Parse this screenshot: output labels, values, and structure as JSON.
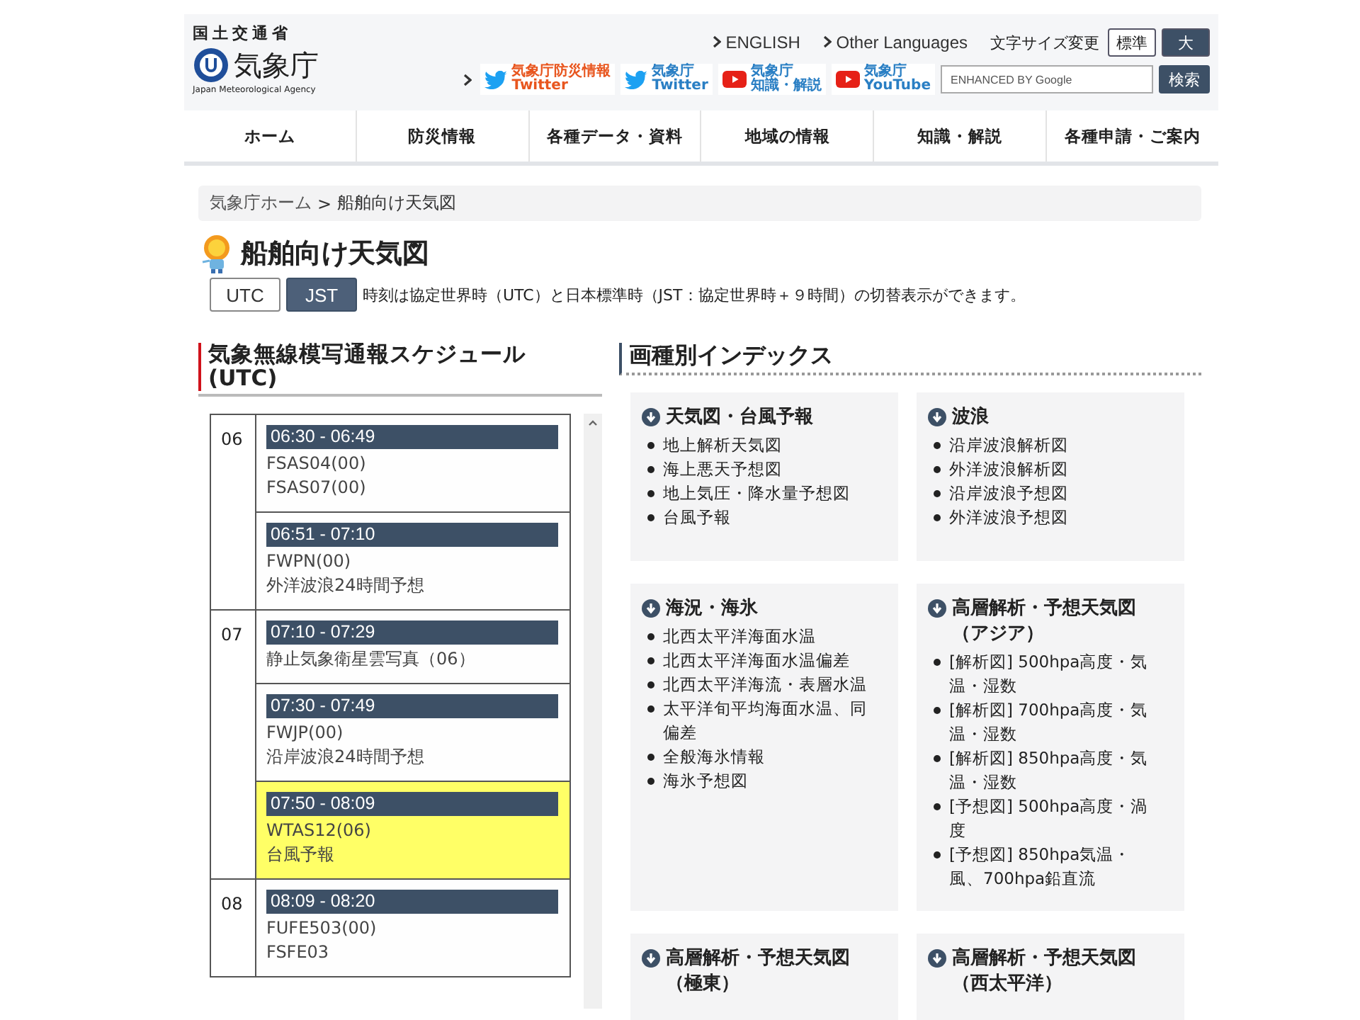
{
  "header": {
    "ministry": "国土交通省",
    "agency": "気象庁",
    "agency_en": "Japan Meteorological Agency",
    "links": [
      "ENGLISH",
      "Other Languages"
    ],
    "font_size": {
      "label": "文字サイズ変更",
      "options": [
        {
          "label": "標準",
          "selected": false
        },
        {
          "label": "大",
          "selected": true
        }
      ]
    },
    "banners": [
      {
        "kind": "twitter",
        "lines": [
          "気象庁防災情報",
          "Twitter"
        ],
        "color": "#e8561f"
      },
      {
        "kind": "twitter",
        "lines": [
          "気象庁",
          "Twitter"
        ],
        "color": "#2a7fc4"
      },
      {
        "kind": "youtube",
        "lines": [
          "気象庁",
          "知識・解説"
        ],
        "color": "#2a7fc4"
      },
      {
        "kind": "youtube",
        "lines": [
          "気象庁",
          "YouTube"
        ],
        "color": "#2a7fc4"
      }
    ],
    "search": {
      "placeholder": "ENHANCED BY Google",
      "button": "検索"
    }
  },
  "nav": [
    "ホーム",
    "防災情報",
    "各種データ・資料",
    "地域の情報",
    "知識・解説",
    "各種申請・ご案内"
  ],
  "breadcrumb": [
    "気象庁ホーム",
    ">",
    "船舶向け天気図"
  ],
  "title": "船舶向け天気図",
  "time_toggle": [
    {
      "label": "UTC",
      "selected": false
    },
    {
      "label": "JST",
      "selected": true
    }
  ],
  "toggle_note": "時刻は協定世界時（UTC）と日本標準時（JST：協定世界時＋９時間）の切替表示ができます。",
  "schedule": {
    "title": "気象無線模写通報スケジュール(UTC)",
    "hours": [
      {
        "hour": "06",
        "slots": [
          {
            "time": "06:30 - 06:49",
            "lines": [
              "FSAS04(00)",
              "FSAS07(00)"
            ],
            "highlighted": false
          },
          {
            "time": "06:51 - 07:10",
            "lines": [
              "FWPN(00)",
              "外洋波浪24時間予想"
            ],
            "highlighted": false
          }
        ]
      },
      {
        "hour": "07",
        "slots": [
          {
            "time": "07:10 - 07:29",
            "lines": [
              "静止気象衛星雲写真（06）"
            ],
            "highlighted": false
          },
          {
            "time": "07:30 - 07:49",
            "lines": [
              "FWJP(00)",
              "沿岸波浪24時間予想"
            ],
            "highlighted": false
          },
          {
            "time": "07:50 - 08:09",
            "lines": [
              "WTAS12(06)",
              "台風予報"
            ],
            "highlighted": true
          }
        ]
      },
      {
        "hour": "08",
        "slots": [
          {
            "time": "08:09 - 08:20",
            "lines": [
              "FUFE503(00)",
              "FSFE03"
            ],
            "highlighted": false
          }
        ]
      }
    ]
  },
  "index": {
    "title": "画種別インデックス",
    "cards": [
      {
        "title": "天気図・台風予報",
        "items": [
          "地上解析天気図",
          "海上悪天予想図",
          "地上気圧・降水量予想図",
          "台風予報"
        ]
      },
      {
        "title": "波浪",
        "items": [
          "沿岸波浪解析図",
          "外洋波浪解析図",
          "沿岸波浪予想図",
          "外洋波浪予想図"
        ]
      },
      {
        "title": "海況・海氷",
        "items": [
          "北西太平洋海面水温",
          "北西太平洋海面水温偏差",
          "北西太平洋海流・表層水温",
          "太平洋旬平均海面水温、同偏差",
          "全般海氷情報",
          "海氷予想図"
        ]
      },
      {
        "title": "高層解析・予想天気図（アジア）",
        "items": [
          "[解析図] 500hpa高度・気温・湿数",
          "[解析図] 700hpa高度・気温・湿数",
          "[解析図] 850hpa高度・気温・湿数",
          "[予想図] 500hpa高度・渦度",
          "[予想図] 850hpa気温・風、700hpa鉛直流"
        ]
      },
      {
        "title": "高層解析・予想天気図（極東）"
      },
      {
        "title": "高層解析・予想天気図（西太平洋）"
      }
    ]
  }
}
